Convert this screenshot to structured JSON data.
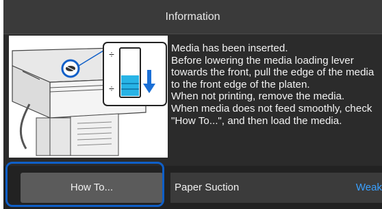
{
  "header": {
    "title": "Information"
  },
  "message": {
    "text": "Media has been inserted.\nBefore lowering the media loading lever towards the front, pull the edge of the media to the front edge of the platen.\nWhen not printing, remove the media.\nWhen media does not feed smoothly, check \"How To...\", and then load the media."
  },
  "illustration": {
    "icons": [
      "printer-icon",
      "media-lever-icon",
      "suction-gauge-icon",
      "down-arrow-icon"
    ],
    "gauge_level": 0.45
  },
  "actions": {
    "howto_label": "How To..."
  },
  "settings": {
    "paper_suction_label": "Paper Suction",
    "paper_suction_value": "Weak"
  },
  "colors": {
    "accent": "#3aa0ff",
    "highlight": "#0f5fc8",
    "background": "#2b2b2b"
  }
}
